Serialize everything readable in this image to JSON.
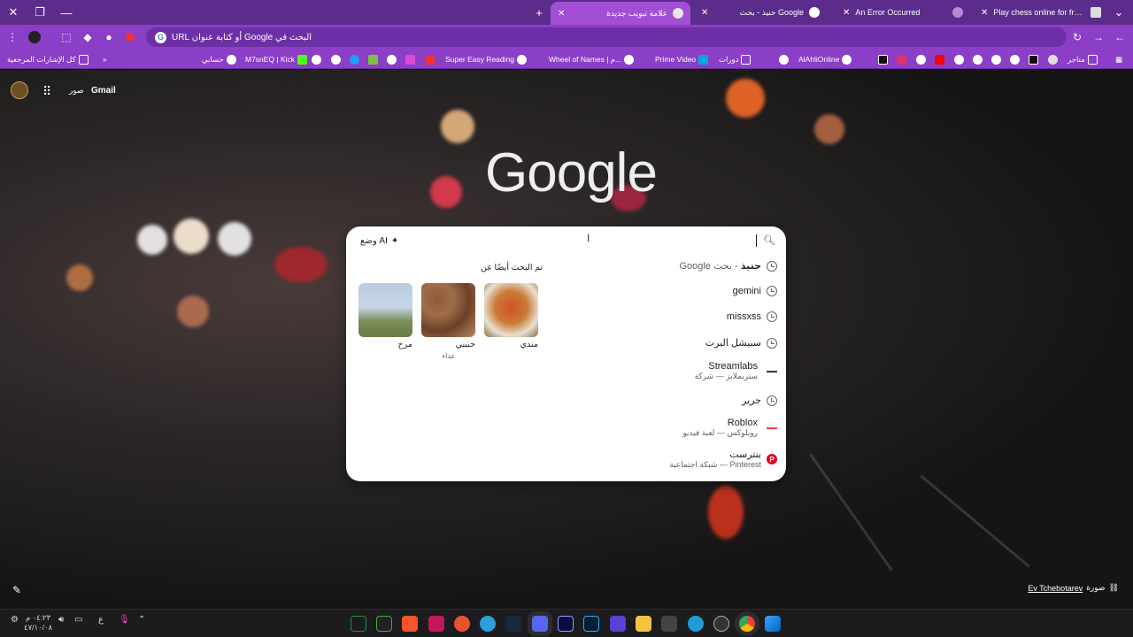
{
  "tabs": [
    {
      "title": "Play chess online for free - chess",
      "active": false
    },
    {
      "title": "An Error Occurred",
      "active": false
    },
    {
      "title": "حنيذ - بحث Google",
      "active": false
    },
    {
      "title": "علامة تبويب جديدة",
      "active": true
    }
  ],
  "new_tab_symbol": "+",
  "omnibox": {
    "placeholder": "البحث في Google أو كتابة عنوان URL"
  },
  "bookmarks": {
    "all_bookmarks": "كل الإشارات المرجعية",
    "items": [
      "متاجر",
      "AlAhliOnline",
      "دورات",
      "Prime Video",
      "Wheel of Names | م...",
      "Super Easy Reading",
      "M7snEQ | Kick",
      "حسابي"
    ]
  },
  "ntp": {
    "gmail": "Gmail",
    "images": "صور",
    "logo": "Google",
    "photo_credit_label": "صورة",
    "photo_credit_author": "Ev Tchebotarev"
  },
  "search": {
    "ai_mode": "وضع AI",
    "suggestions": [
      {
        "text": "حنيذ",
        "suffix": " - بحث Google",
        "icon": "history-icon"
      },
      {
        "text": "gemini",
        "icon": "history-icon"
      },
      {
        "text": "missxss",
        "icon": "history-icon"
      },
      {
        "text": "سبيشل البرت",
        "icon": "history-icon"
      },
      {
        "text": "Streamlabs",
        "sub": "ستريملابز — شركة",
        "icon": "streamlabs-logo"
      },
      {
        "text": "جرير",
        "icon": "history-icon"
      },
      {
        "text": "Roblox",
        "sub": "روبلوكس — لعبة فيديو",
        "icon": "roblox-logo"
      },
      {
        "text": "بنترست",
        "sub": "Pinterest — شبكة اجتماعية",
        "icon": "pinterest-icon"
      }
    ],
    "also_searched_title": "تم البحث أيضًا عن",
    "related": [
      {
        "label": "مندي",
        "sub": ""
      },
      {
        "label": "حنيني",
        "sub": "غذاء"
      },
      {
        "label": "مرخ",
        "sub": ""
      }
    ]
  },
  "taskbar": {
    "time": "٠٤:٢٣ م",
    "date": "٤٧/١٠/٠٨",
    "lang": "ع"
  },
  "colors": {
    "tabstrip": "#5b2c8c",
    "toolbar": "#8a3fc6",
    "active_tab": "#a24fd6"
  }
}
